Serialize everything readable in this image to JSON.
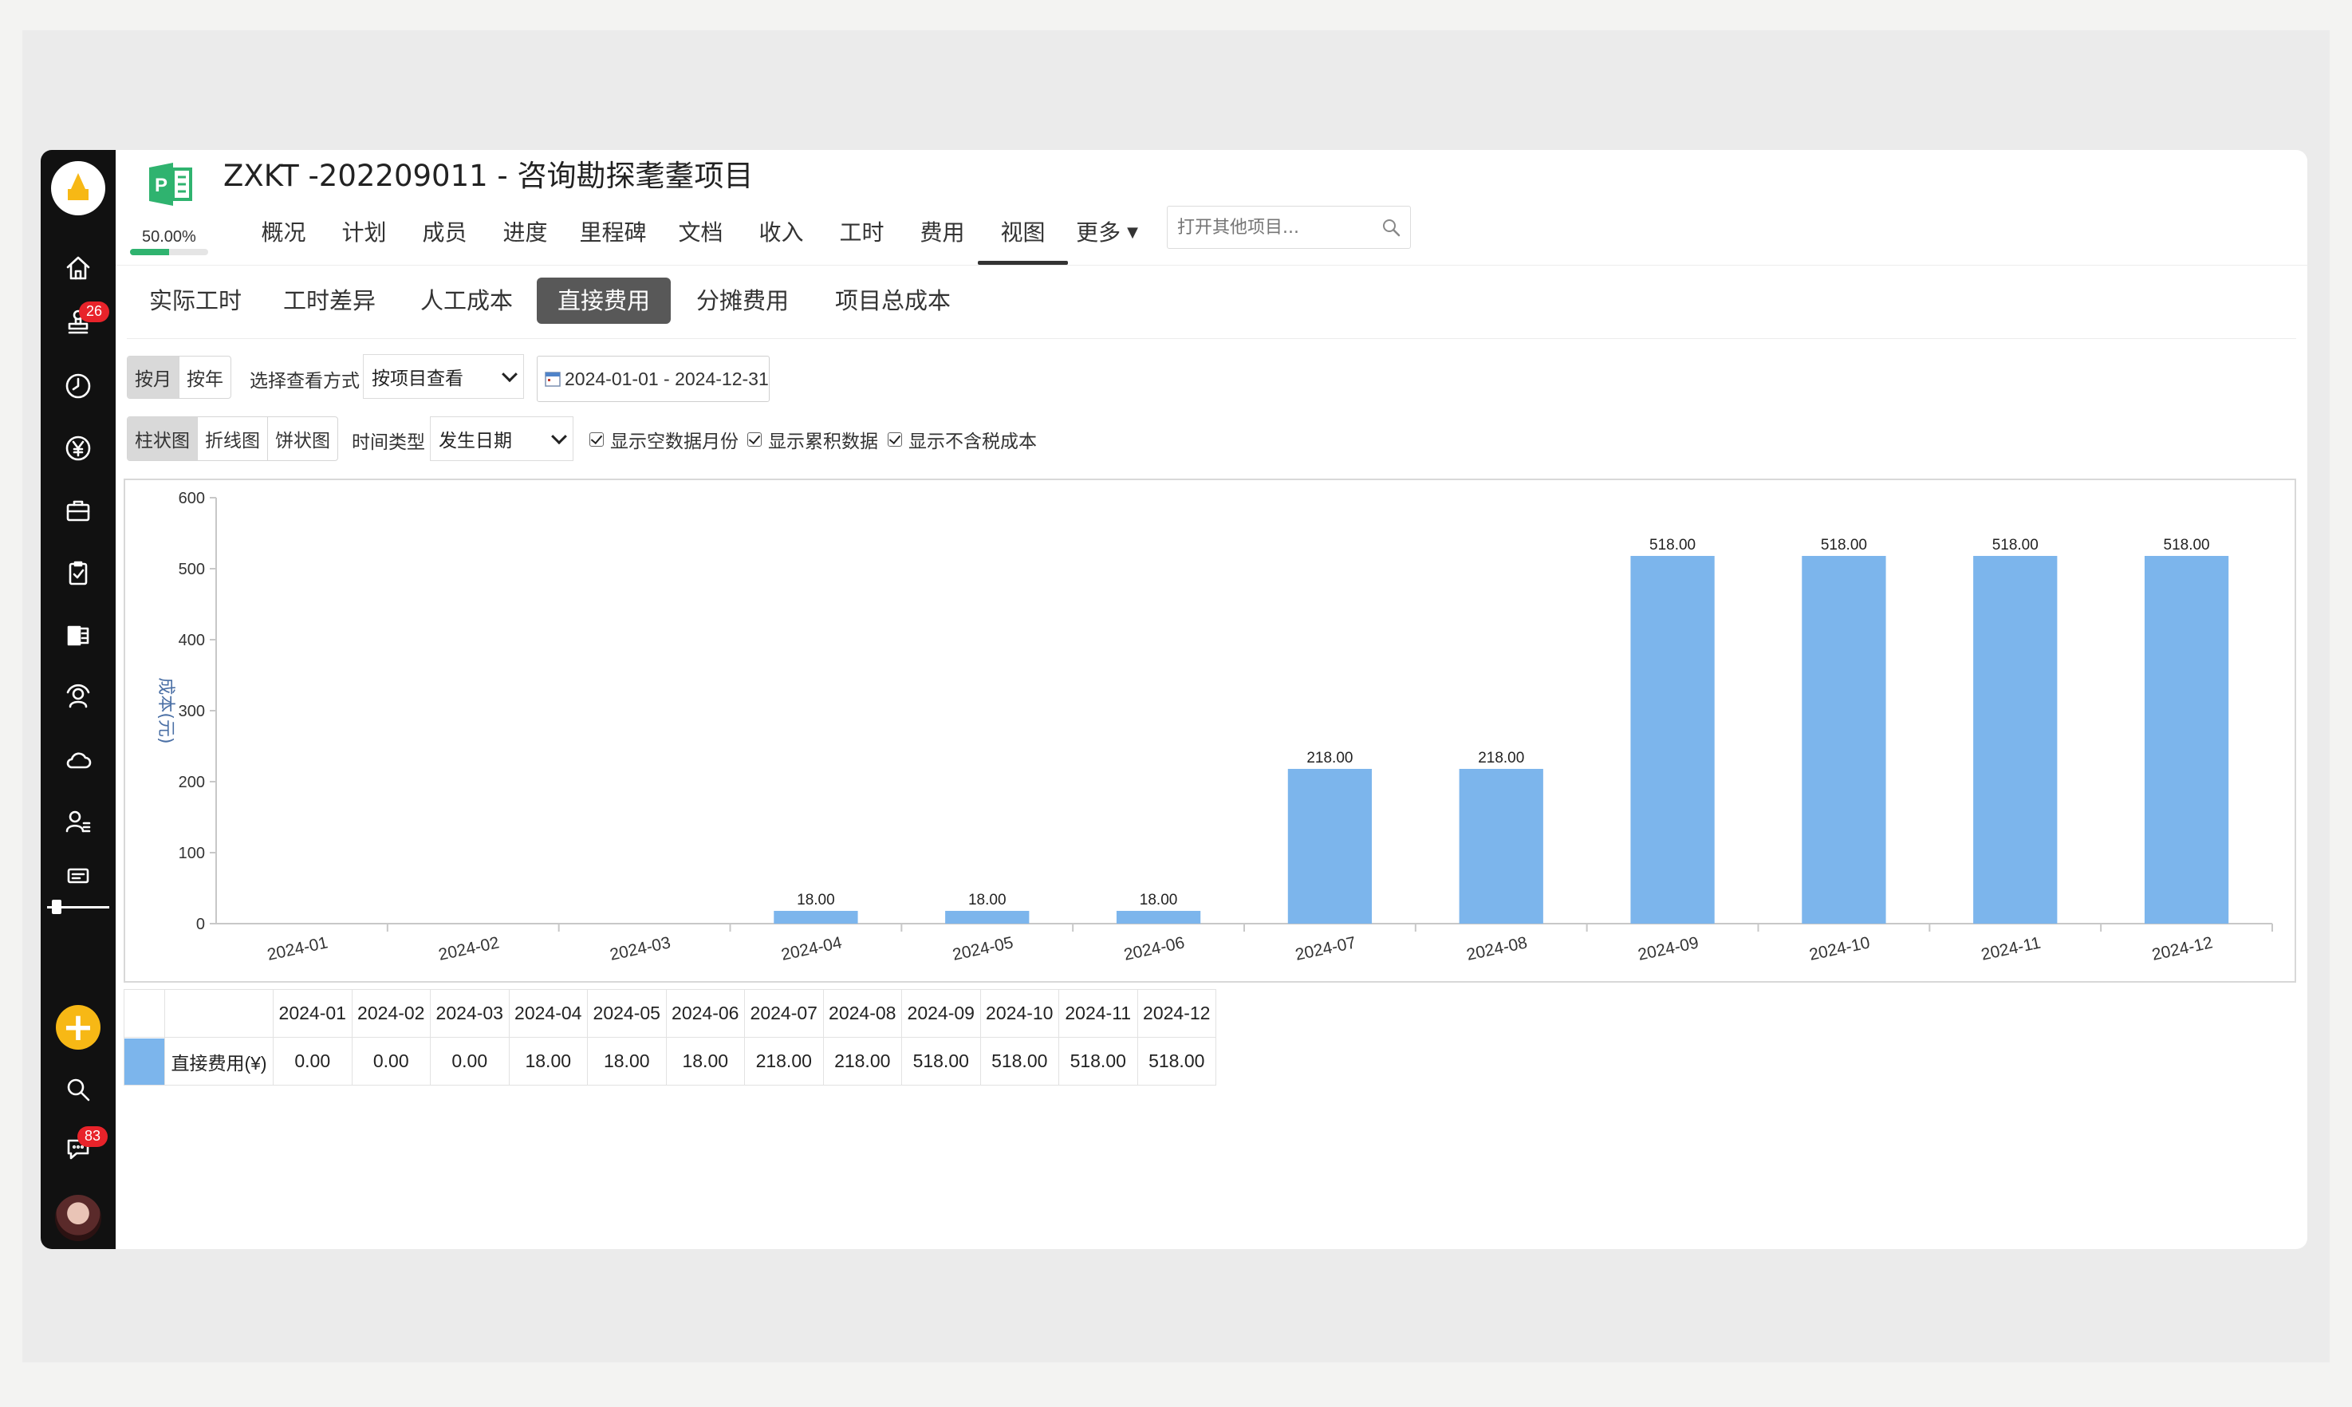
{
  "colors": {
    "bar": "#7cb5ec",
    "sidebar": "#111111",
    "accent_yellow": "#f7b815",
    "progress": "#2fb36f",
    "badge": "#e8232a"
  },
  "sidebar": {
    "icons": [
      "home-icon",
      "stamp-icon",
      "clock-icon",
      "yen-icon",
      "briefcase-icon",
      "clipboard-check-icon",
      "project-icon",
      "team-icon",
      "cloud-icon",
      "user-list-icon",
      "message-board-icon"
    ],
    "stamp_badge": "26",
    "chat_badge": "83"
  },
  "project": {
    "title": "ZXKT -202209011 - 咨询勘探耄耋项目",
    "percent": "50.00%",
    "progress": 0.5
  },
  "nav": {
    "items": [
      "概况",
      "计划",
      "成员",
      "进度",
      "里程碑",
      "文档",
      "收入",
      "工时",
      "费用",
      "视图",
      "更多"
    ],
    "active": "视图",
    "search_placeholder": "打开其他项目..."
  },
  "subtabs": {
    "items": [
      "实际工时",
      "工时差异",
      "人工成本",
      "直接费用",
      "分摊费用",
      "项目总成本"
    ],
    "active": "直接费用"
  },
  "filters": {
    "period": [
      "按月",
      "按年"
    ],
    "view_mode_label": "选择查看方式",
    "view_mode_value": "按项目查看",
    "date_range": "2024-01-01 - 2024-12-31",
    "chart_types": [
      "柱状图",
      "折线图",
      "饼状图"
    ],
    "time_type_label": "时间类型",
    "time_type_value": "发生日期",
    "checkboxes": [
      "显示空数据月份",
      "显示累积数据",
      "显示不含税成本"
    ]
  },
  "chart_data": {
    "type": "bar",
    "categories": [
      "2024-01",
      "2024-02",
      "2024-03",
      "2024-04",
      "2024-05",
      "2024-06",
      "2024-07",
      "2024-08",
      "2024-09",
      "2024-10",
      "2024-11",
      "2024-12"
    ],
    "values": [
      0,
      0,
      0,
      18,
      18,
      18,
      218,
      218,
      518,
      518,
      518,
      518
    ],
    "data_labels": [
      "",
      "",
      "",
      "18.00",
      "18.00",
      "18.00",
      "218.00",
      "218.00",
      "518.00",
      "518.00",
      "518.00",
      "518.00"
    ],
    "ylabel": "成本(元)",
    "ylim": [
      0,
      600
    ],
    "yticks": [
      "0",
      "100",
      "200",
      "300",
      "400",
      "500",
      "600"
    ],
    "grid": false,
    "legend": "none"
  },
  "table": {
    "row_label": "直接费用(¥)",
    "months": [
      "2024-01",
      "2024-02",
      "2024-03",
      "2024-04",
      "2024-05",
      "2024-06",
      "2024-07",
      "2024-08",
      "2024-09",
      "2024-10",
      "2024-11",
      "2024-12"
    ],
    "values": [
      "0.00",
      "0.00",
      "0.00",
      "18.00",
      "18.00",
      "18.00",
      "218.00",
      "218.00",
      "518.00",
      "518.00",
      "518.00",
      "518.00"
    ]
  }
}
